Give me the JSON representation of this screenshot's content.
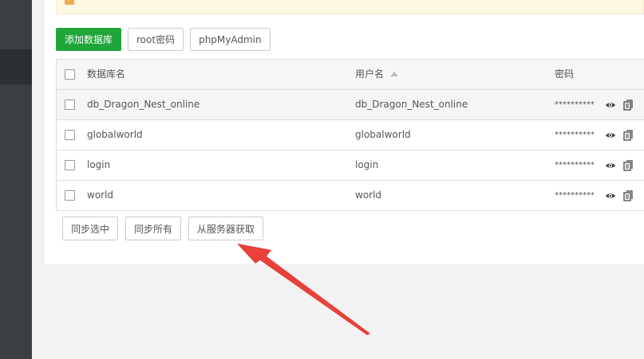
{
  "toolbar": {
    "add_db_label": "添加数据库",
    "root_pwd_label": "root密码",
    "phpmyadmin_label": "phpMyAdmin"
  },
  "table": {
    "headers": {
      "name": "数据库名",
      "user": "用户名",
      "password": "密码"
    },
    "rows": [
      {
        "name": "db_Dragon_Nest_online",
        "user": "db_Dragon_Nest_online",
        "password": "**********"
      },
      {
        "name": "globalworld",
        "user": "globalworld",
        "password": "**********"
      },
      {
        "name": "login",
        "user": "login",
        "password": "**********"
      },
      {
        "name": "world",
        "user": "world",
        "password": "**********"
      }
    ]
  },
  "bottom": {
    "sync_selected_label": "同步选中",
    "sync_all_label": "同步所有",
    "fetch_from_server_label": "从服务器获取"
  },
  "colors": {
    "primary": "#20a53a",
    "sidebar": "#3a3f44",
    "arrow": "#e8403a"
  }
}
